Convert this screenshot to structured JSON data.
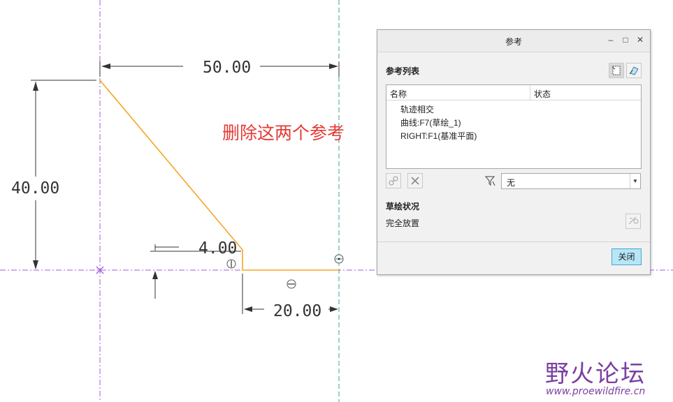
{
  "sketch": {
    "dimensions": {
      "top": "50.00",
      "left": "40.00",
      "chamfer": "4.00",
      "bottom": "20.00"
    }
  },
  "annotation": {
    "text": "删除这两个参考",
    "color": "#e53935"
  },
  "dialog": {
    "title": "参考",
    "minimize_icon": "minimize-icon",
    "restore_icon": "restore-icon",
    "close_icon": "close-icon",
    "ref_list_label": "参考列表",
    "columns": {
      "name": "名称",
      "status": "状态"
    },
    "rows": [
      "轨迹相交",
      "曲线:F7(草绘_1)",
      "RIGHT:F1(基准平面)"
    ],
    "filter": {
      "value": "无"
    },
    "sketch_status_label": "草绘状况",
    "sketch_status_value": "完全放置",
    "close_button": "关闭",
    "accent": "#b6e7f6"
  },
  "watermark": {
    "main": "野火论坛",
    "sub": "www.proewildfire.cn"
  }
}
